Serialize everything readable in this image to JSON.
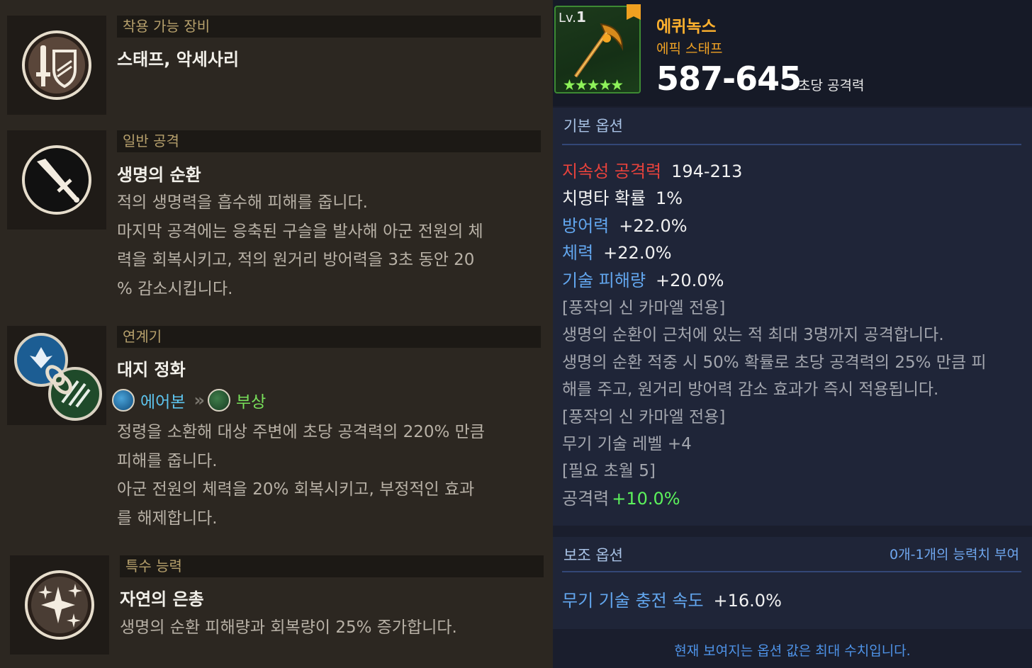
{
  "left": {
    "equip": {
      "header": "착용 가능 장비",
      "name": "스태프, 악세사리",
      "icon": "sword-shield-icon"
    },
    "basic_attack": {
      "header": "일반 공격",
      "name": "생명의 순환",
      "icon": "staff-attack-icon",
      "desc": [
        "적의 생명력을 흡수해 피해를 줍니다.",
        "마지막 공격에는 응축된 구슬을 발사해 아군 전원의 체",
        "력을 회복시키고, 적의 원거리 방어력을 3초 동안 20",
        "% 감소시킵니다."
      ]
    },
    "chain": {
      "header": "연계기",
      "name": "대지 정화",
      "icon": "chain-skill-icon",
      "from_label": "에어본",
      "to_label": "부상",
      "arrow": "»",
      "desc": [
        "정령을 소환해 대상 주변에 초당 공격력의 220% 만큼",
        "피해를 줍니다.",
        "아군 전원의 체력을 20% 회복시키고, 부정적인 효과",
        "를 해제합니다."
      ]
    },
    "special": {
      "header": "특수 능력",
      "name": "자연의 은총",
      "icon": "sparkle-icon",
      "desc": [
        "생명의 순환 피해량과 회복량이 25% 증가합니다."
      ]
    }
  },
  "item": {
    "level_prefix": "Lv.",
    "level": "1",
    "stars": "★★★★★",
    "name": "에퀴녹스",
    "type": "에픽 스태프",
    "damage": "587-645",
    "damage_label": "초당 공격력",
    "colors": {
      "epic": "#ffb12e",
      "star": "#8ef25a"
    }
  },
  "basic_options": {
    "title": "기본 옵션",
    "stats": [
      {
        "key": "지속성 공격력",
        "value": "194-213"
      },
      {
        "key": "치명타 확률",
        "value": "1%"
      },
      {
        "key": "방어력",
        "value": "+22.0%"
      },
      {
        "key": "체력",
        "value": "+22.0%"
      },
      {
        "key": "기술 피해량",
        "value": "+20.0%"
      }
    ],
    "notes": [
      "[풍작의 신 카마엘 전용]",
      "생명의 순환이 근처에 있는 적 최대 3명까지 공격합니다.",
      "생명의 순환 적중 시 50% 확률로 초당 공격력의 25% 만큼 피",
      "해를 주고, 원거리 방어력 감소 효과가 즉시 적용됩니다.",
      "[풍작의 신 카마엘 전용]",
      "무기 기술 레벨 +4",
      "[필요 초월 5]"
    ],
    "bonus": {
      "key": "공격력",
      "value": "+10.0%"
    }
  },
  "sub_options": {
    "title": "보조 옵션",
    "note": "0개-1개의 능력치 부여",
    "stats": [
      {
        "key": "무기 기술 충전 속도",
        "value": "+16.0%"
      }
    ]
  },
  "footer": "현재 보여지는 옵션 값은 최대 수치입니다."
}
